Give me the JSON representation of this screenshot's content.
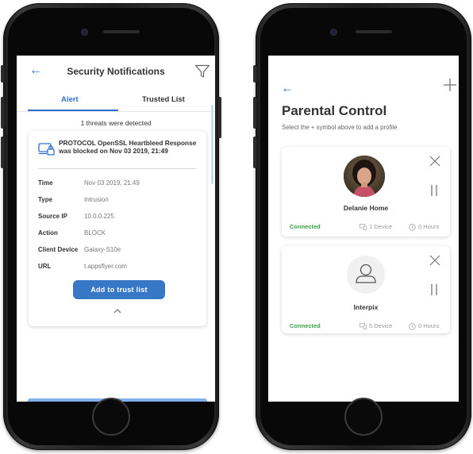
{
  "left_screen": {
    "title": "Security Notifications",
    "tabs": [
      {
        "label": "Alert",
        "active": true
      },
      {
        "label": "Trusted List",
        "active": false
      }
    ],
    "threat_count_text": "1 threats were detected",
    "alert": {
      "message": "PROTOCOL OpenSSL Heartbleed Response was blocked on Nov 03 2019, 21:49",
      "details": [
        {
          "key": "Time",
          "value": "Nov 03 2019, 21:49"
        },
        {
          "key": "Type",
          "value": "Intrusion"
        },
        {
          "key": "Source IP",
          "value": "10.0.0.225"
        },
        {
          "key": "Action",
          "value": "BLOCK"
        },
        {
          "key": "Client Device",
          "value": "Galaxy-S10e"
        },
        {
          "key": "URL",
          "value": "t.appsflyer.com"
        }
      ],
      "button_label": "Add to trust list"
    },
    "icons": {
      "back": "back-arrow-icon",
      "filter": "filter-icon",
      "lock": "device-lock-icon",
      "collapse": "chevron-up-icon"
    },
    "colors": {
      "accent": "#2f6fcf",
      "button": "#3677c6"
    }
  },
  "right_screen": {
    "title": "Parental Control",
    "subtitle": "Select the + symbol above to add a profile",
    "profiles": [
      {
        "name": "Delanie Home",
        "status": "Connected",
        "devices": "1 Device",
        "hours": "0 Hours",
        "avatar": "photo"
      },
      {
        "name": "Interpix",
        "status": "Connected",
        "devices": "5 Device",
        "hours": "0 Hours",
        "avatar": "generic-user"
      }
    ],
    "icons": {
      "back": "back-arrow-icon",
      "add": "plus-icon",
      "remove": "close-icon",
      "pause": "pause-icon",
      "devices": "devices-icon",
      "hours": "clock-icon"
    },
    "colors": {
      "connected": "#3da047"
    }
  }
}
